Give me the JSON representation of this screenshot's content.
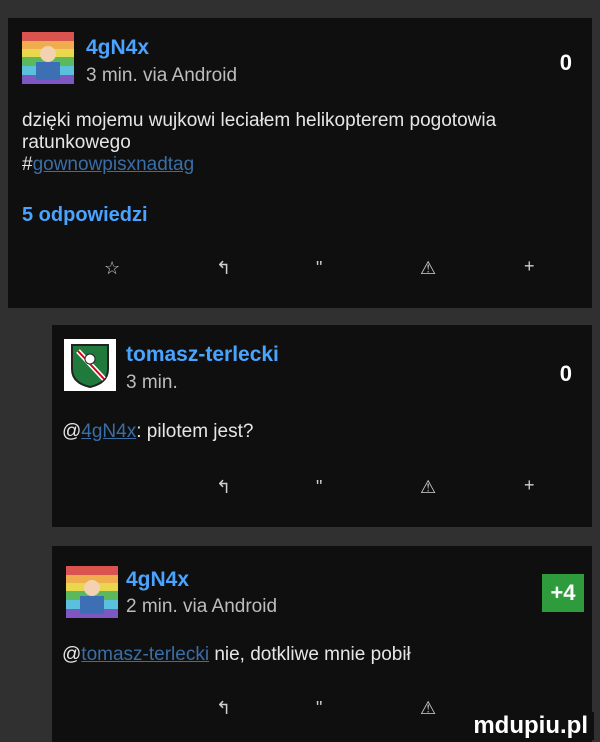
{
  "comments": [
    {
      "username": "4gN4x",
      "meta": "3 min. via Android",
      "score": "0",
      "text_lines": [
        "dzięki mojemu wujkowi leciałem helikopterem pogotowia",
        "ratunkowego"
      ],
      "hashtag_prefix": "#",
      "hashtag": "gownowpisxnadtag",
      "replies_label": "5 odpowiedzi",
      "actions": [
        "☆",
        "↰",
        "\"",
        "⚠",
        "+"
      ]
    },
    {
      "username": "tomasz-terlecki",
      "meta": "3 min.",
      "score": "0",
      "mention_prefix": "@",
      "mention": "4gN4x",
      "text_after_mention": ": pilotem jest?",
      "actions": [
        "↰",
        "\"",
        "⚠",
        "+"
      ]
    },
    {
      "username": "4gN4x",
      "meta": "2 min. via Android",
      "score": "+4",
      "mention_prefix": "@",
      "mention": "tomasz-terlecki",
      "text_after_mention": " nie, dotkliwe mnie pobił",
      "actions": [
        "↰",
        "\"",
        "⚠"
      ]
    }
  ],
  "watermark": "mdupiu.pl"
}
